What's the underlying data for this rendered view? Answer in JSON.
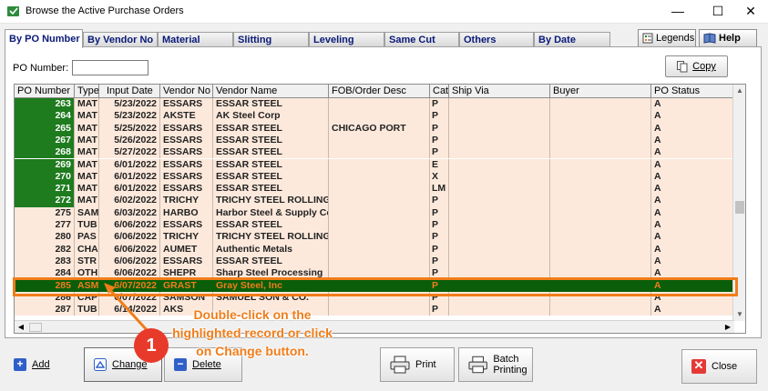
{
  "window": {
    "title": "Browse the Active Purchase Orders",
    "minimize_glyph": "—",
    "maximize_glyph": "☐",
    "close_glyph": "✕"
  },
  "tabs": [
    {
      "label": "By PO Number",
      "active": true
    },
    {
      "label": "By Vendor No",
      "active": false
    },
    {
      "label": "Material",
      "active": false
    },
    {
      "label": "Slitting",
      "active": false
    },
    {
      "label": "Leveling",
      "active": false
    },
    {
      "label": "Same Cut",
      "active": false
    },
    {
      "label": "Others",
      "active": false
    },
    {
      "label": "By Date",
      "active": false
    }
  ],
  "top_buttons": {
    "legends": "Legends",
    "help": "Help"
  },
  "search": {
    "label": "PO Number:",
    "value": ""
  },
  "copy_button": "Copy",
  "grid": {
    "columns": [
      "PO Number",
      "Type",
      "Input Date",
      "Vendor No",
      "Vendor Name",
      "FOB/Order Desc",
      "Cat",
      "Ship Via",
      "Buyer",
      "PO Status"
    ],
    "rows": [
      {
        "po": "263",
        "type": "MAT",
        "date": "5/23/2022",
        "vendor_no": "ESSARS",
        "vendor_name": " ESSAR STEEL",
        "fob": "",
        "cat": "P",
        "ship_via": "",
        "buyer": "",
        "status": "A",
        "style": "green"
      },
      {
        "po": "264",
        "type": "MAT",
        "date": "5/23/2022",
        "vendor_no": "AKSTE",
        "vendor_name": "AK Steel Corp",
        "fob": "",
        "cat": "P",
        "ship_via": "",
        "buyer": "",
        "status": "A",
        "style": "green"
      },
      {
        "po": "265",
        "type": "MAT",
        "date": "5/25/2022",
        "vendor_no": "ESSARS",
        "vendor_name": " ESSAR STEEL",
        "fob": "CHICAGO PORT",
        "cat": "P",
        "ship_via": "",
        "buyer": "",
        "status": "A",
        "style": "green"
      },
      {
        "po": "267",
        "type": "MAT",
        "date": "5/26/2022",
        "vendor_no": "ESSARS",
        "vendor_name": " ESSAR STEEL",
        "fob": "",
        "cat": "P",
        "ship_via": "",
        "buyer": "",
        "status": "A",
        "style": "green"
      },
      {
        "po": "268",
        "type": "MAT",
        "date": "5/27/2022",
        "vendor_no": "ESSARS",
        "vendor_name": " ESSAR STEEL",
        "fob": "",
        "cat": "P",
        "ship_via": "",
        "buyer": "",
        "status": "A",
        "style": "green"
      },
      {
        "po": "269",
        "type": "MAT",
        "date": "6/01/2022",
        "vendor_no": "ESSARS",
        "vendor_name": " ESSAR STEEL",
        "fob": "",
        "cat": "E",
        "ship_via": "",
        "buyer": "",
        "status": "A",
        "style": "green"
      },
      {
        "po": "270",
        "type": "MAT",
        "date": "6/01/2022",
        "vendor_no": "ESSARS",
        "vendor_name": " ESSAR STEEL",
        "fob": "",
        "cat": "X",
        "ship_via": "",
        "buyer": "",
        "status": "A",
        "style": "green"
      },
      {
        "po": "271",
        "type": "MAT",
        "date": "6/01/2022",
        "vendor_no": "ESSARS",
        "vendor_name": " ESSAR STEEL",
        "fob": "",
        "cat": "LM",
        "ship_via": "",
        "buyer": "",
        "status": "A",
        "style": "green"
      },
      {
        "po": "272",
        "type": "MAT",
        "date": "6/02/2022",
        "vendor_no": "TRICHY",
        "vendor_name": "TRICHY STEEL ROLLING MI",
        "fob": "",
        "cat": "P",
        "ship_via": "",
        "buyer": "",
        "status": "A",
        "style": "green"
      },
      {
        "po": "275",
        "type": "SAM",
        "date": "6/03/2022",
        "vendor_no": "HARBO",
        "vendor_name": "Harbor Steel & Supply Corp",
        "fob": "",
        "cat": "P",
        "ship_via": "",
        "buyer": "",
        "status": "A",
        "style": "plain"
      },
      {
        "po": "277",
        "type": "TUB",
        "date": "6/06/2022",
        "vendor_no": "ESSARS",
        "vendor_name": " ESSAR STEEL",
        "fob": "",
        "cat": "P",
        "ship_via": "",
        "buyer": "",
        "status": "A",
        "style": "plain"
      },
      {
        "po": "280",
        "type": "PAS",
        "date": "6/06/2022",
        "vendor_no": "TRICHY",
        "vendor_name": "TRICHY STEEL ROLLING MI",
        "fob": "",
        "cat": "P",
        "ship_via": "",
        "buyer": "",
        "status": "A",
        "style": "plain"
      },
      {
        "po": "282",
        "type": "CHA",
        "date": "6/06/2022",
        "vendor_no": "AUMET",
        "vendor_name": "Authentic Metals",
        "fob": "",
        "cat": "P",
        "ship_via": "",
        "buyer": "",
        "status": "A",
        "style": "plain"
      },
      {
        "po": "283",
        "type": "STR",
        "date": "6/06/2022",
        "vendor_no": "ESSARS",
        "vendor_name": " ESSAR STEEL",
        "fob": "",
        "cat": "P",
        "ship_via": "",
        "buyer": "",
        "status": "A",
        "style": "plain"
      },
      {
        "po": "284",
        "type": "OTH",
        "date": "6/06/2022",
        "vendor_no": "SHEPR",
        "vendor_name": "Sharp Steel Processing",
        "fob": "",
        "cat": "P",
        "ship_via": "",
        "buyer": "",
        "status": "A",
        "style": "plain"
      },
      {
        "po": "285",
        "type": "ASM",
        "date": "6/07/2022",
        "vendor_no": "GRAST",
        "vendor_name": "Gray Steel, Inc",
        "fob": "",
        "cat": "P",
        "ship_via": "",
        "buyer": "",
        "status": "A",
        "style": "selected"
      },
      {
        "po": "286",
        "type": "CAP",
        "date": "6/07/2022",
        "vendor_no": "SAMSON",
        "vendor_name": "SAMUEL SON & CO.",
        "fob": "",
        "cat": "P",
        "ship_via": "",
        "buyer": "",
        "status": "A",
        "style": "plain"
      },
      {
        "po": "287",
        "type": "TUB",
        "date": "6/14/2022",
        "vendor_no": "AKS",
        "vendor_name": "",
        "fob": "",
        "cat": "P",
        "ship_via": "",
        "buyer": "",
        "status": "A",
        "style": "plain"
      }
    ]
  },
  "bottom_buttons": {
    "add": "Add",
    "change": "Change",
    "delete": "Delete",
    "print": "Print",
    "batch_printing": "Batch Printing",
    "close": "Close"
  },
  "callout": {
    "number": "1",
    "text": "Double-click on the highlighted record or click on Change button.",
    "color": "#f07d1a"
  },
  "colors": {
    "green_cell": "#1e7b1e",
    "selected_row": "#0a5e0a",
    "row_bg": "#fce9dc",
    "highlight": "#f07d1a"
  }
}
